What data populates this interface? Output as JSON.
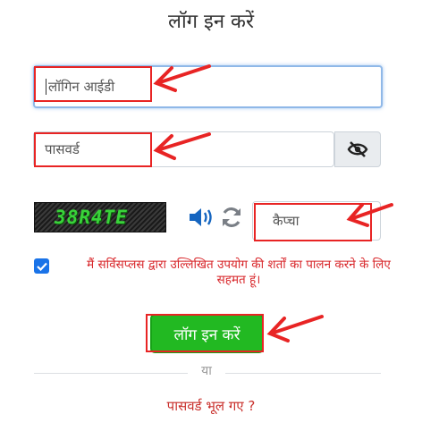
{
  "header": {
    "title": "लॉग इन करें"
  },
  "form": {
    "login_placeholder": "लॉगिन आईडी",
    "password_placeholder": "पासवर्ड",
    "password_toggle_icon": "eye-slash-icon",
    "captcha_code": "38R4TE",
    "captcha_audio_icon": "speaker-icon",
    "captcha_refresh_icon": "refresh-icon",
    "captcha_placeholder": "कैप्चा",
    "terms_checked": true,
    "terms_text": "मैं सर्विसप्लस द्वारा उल्लिखित उपयोग की शर्तों का पालन करने के लिए सहमत हूं।",
    "login_button": "लॉग इन करें",
    "divider_text": "या",
    "forgot_password": "पासवर्ड भूल गए ?"
  },
  "colors": {
    "accent_green": "#22b922",
    "link_red": "#c9302c",
    "annotation_red": "#e82424",
    "checkbox_blue": "#1a73e8"
  }
}
